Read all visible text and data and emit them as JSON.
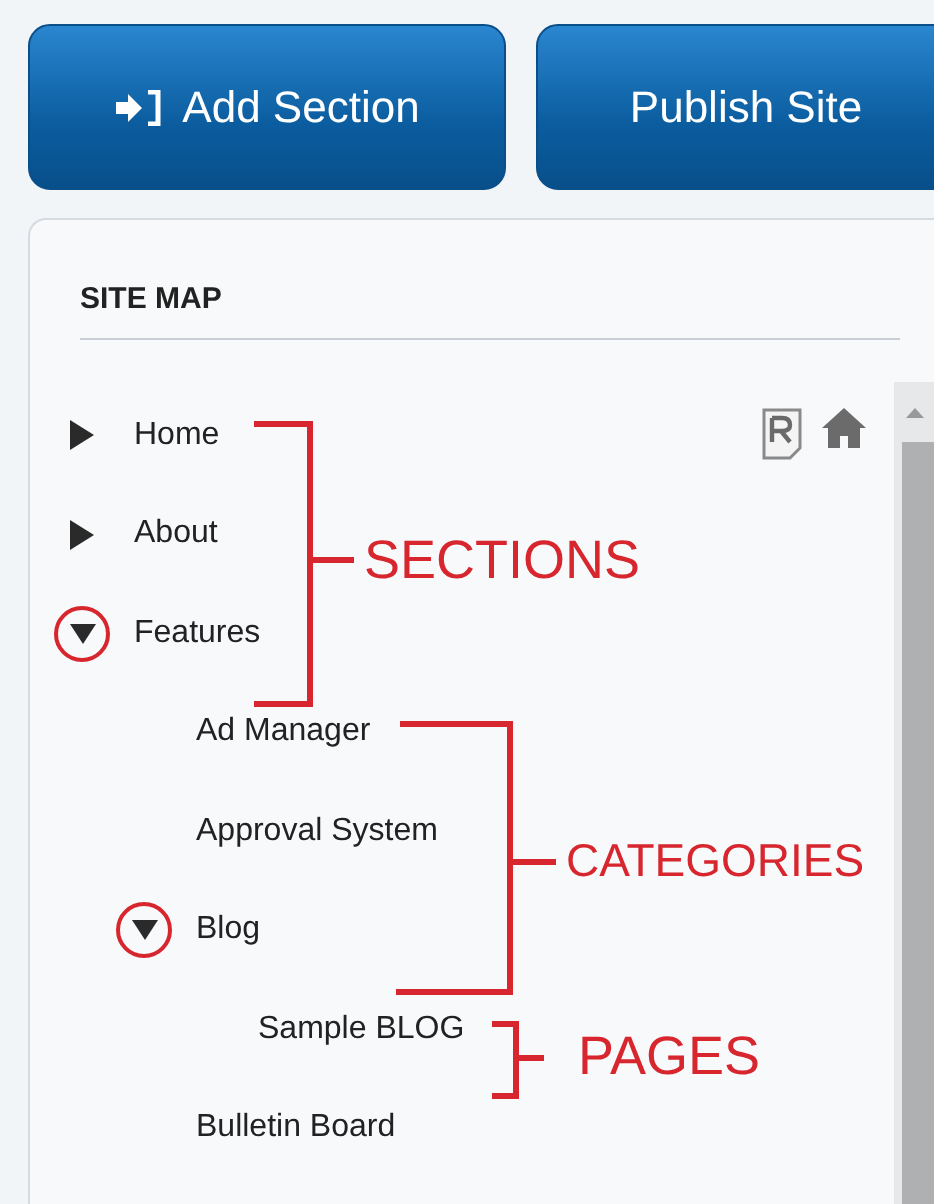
{
  "toolbar": {
    "buttons": [
      {
        "label": "Add Section",
        "kind": "add"
      },
      {
        "label": "Publish Site",
        "kind": "plain"
      }
    ]
  },
  "site_map": {
    "title": "SITE MAP",
    "tree": [
      {
        "label": "Home",
        "kind": "branch",
        "expanded": false,
        "circled": false
      },
      {
        "label": "About",
        "kind": "branch",
        "expanded": false,
        "circled": false
      },
      {
        "label": "Features",
        "kind": "branch",
        "expanded": true,
        "circled": true,
        "children": [
          {
            "label": "Ad Manager",
            "kind": "leaf"
          },
          {
            "label": "Approval System",
            "kind": "leaf"
          },
          {
            "label": "Blog",
            "kind": "branch",
            "expanded": true,
            "circled": true,
            "children": [
              {
                "label": "Sample BLOG",
                "kind": "leaf"
              }
            ]
          },
          {
            "label": "Bulletin Board",
            "kind": "leaf"
          }
        ]
      }
    ]
  },
  "annotations": [
    {
      "label": "SECTIONS"
    },
    {
      "label": "CATEGORIES"
    },
    {
      "label": "PAGES"
    }
  ]
}
